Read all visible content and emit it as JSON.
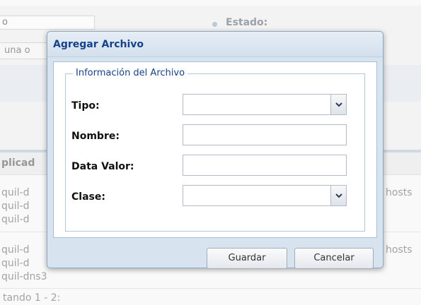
{
  "background": {
    "search_value": "o",
    "select_value": "una o",
    "estado_label": "Estado:",
    "grid_header": "plicad",
    "rows": [
      {
        "text": "quil-d",
        "right": "hosts"
      },
      {
        "text": "quil-d",
        "right": ""
      },
      {
        "text": "quil-d",
        "right": ""
      },
      {
        "text": "quil-d",
        "right": "hosts"
      },
      {
        "text": "quil-d",
        "right": ""
      },
      {
        "text": "quil-dns3",
        "right": ""
      }
    ],
    "footer": "tando 1 - 2:"
  },
  "dialog": {
    "title": "Agregar Archivo",
    "fieldset_legend": "Información del Archivo",
    "fields": {
      "tipo": {
        "label": "Tipo:",
        "value": ""
      },
      "nombre": {
        "label": "Nombre:",
        "value": ""
      },
      "data_valor": {
        "label": "Data Valor:",
        "value": ""
      },
      "clase": {
        "label": "Clase:",
        "value": ""
      }
    },
    "buttons": {
      "save": "Guardar",
      "cancel": "Cancelar"
    }
  },
  "icons": {
    "combo_trigger": "chevron-down-icon",
    "status_dot": "dot-icon"
  },
  "colors": {
    "title_text": "#15428b",
    "dialog_bg": "#d7e3ef",
    "dialog_border": "#8ea9c8"
  }
}
